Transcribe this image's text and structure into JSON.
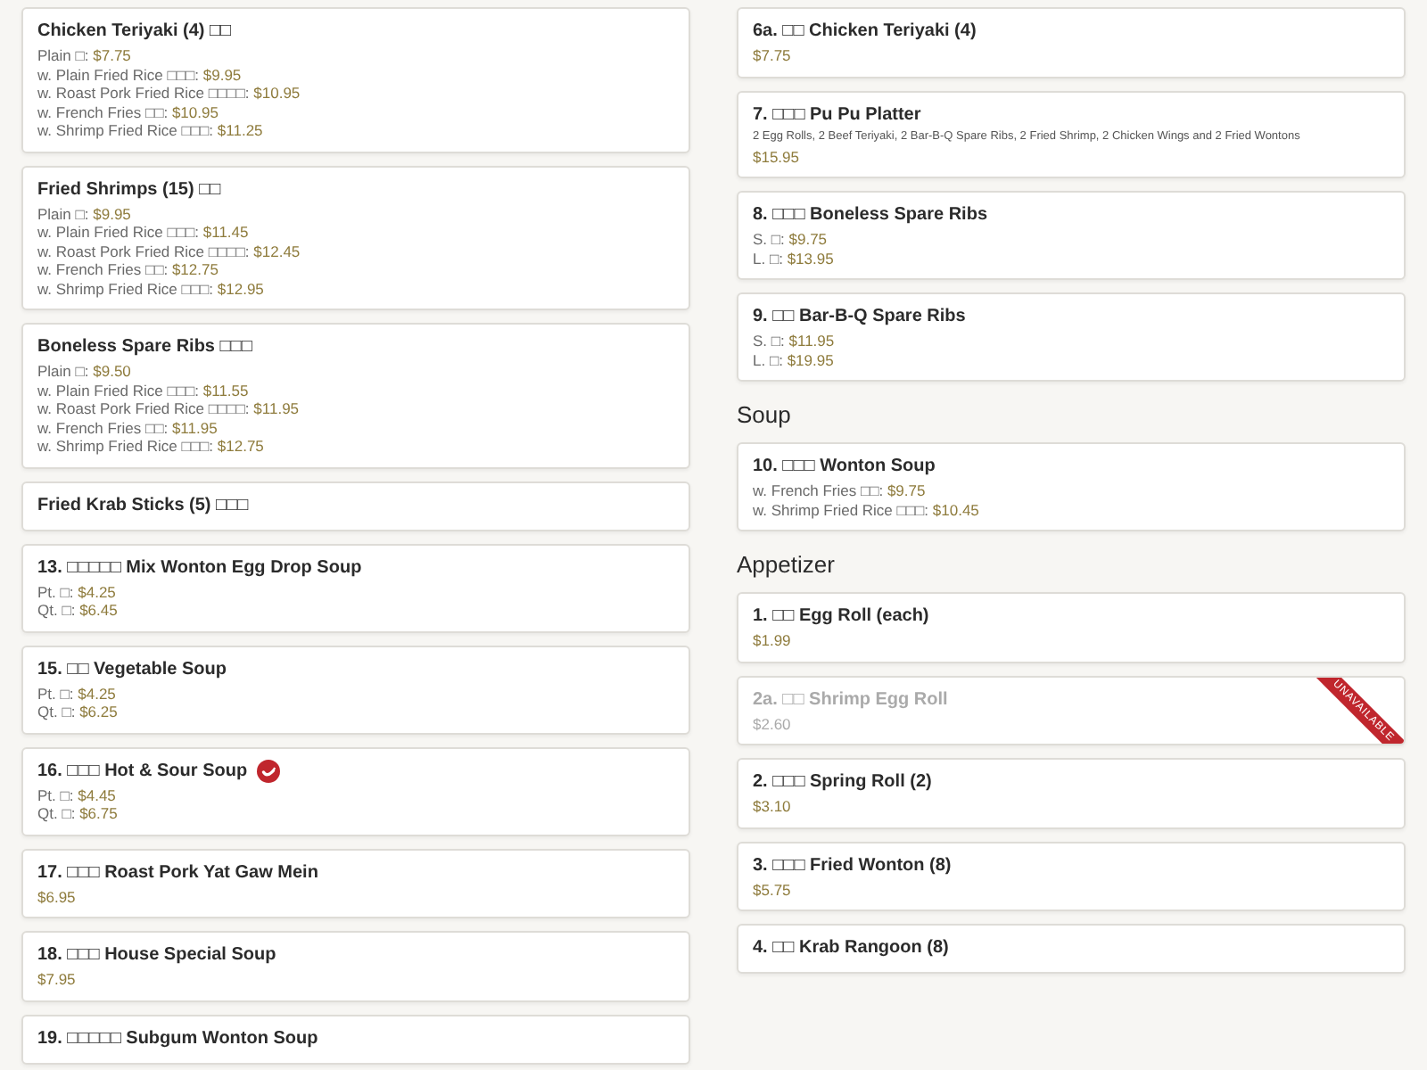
{
  "columns": [
    {
      "blocks": [
        {
          "kind": "card",
          "title": "Chicken Teriyaki (4) □□",
          "prices": [
            {
              "label": "Plain □:",
              "price": "$7.75"
            },
            {
              "label": "w. Plain Fried Rice □□□:",
              "price": "$9.95"
            },
            {
              "label": "w. Roast Pork Fried Rice □□□□:",
              "price": "$10.95"
            },
            {
              "label": "w. French Fries □□:",
              "price": "$10.95"
            },
            {
              "label": "w. Shrimp Fried Rice □□□:",
              "price": "$11.25"
            }
          ]
        },
        {
          "kind": "card",
          "title": "Fried Shrimps (15) □□",
          "prices": [
            {
              "label": "Plain □:",
              "price": "$9.95"
            },
            {
              "label": "w. Plain Fried Rice □□□:",
              "price": "$11.45"
            },
            {
              "label": "w. Roast Pork Fried Rice □□□□:",
              "price": "$12.45"
            },
            {
              "label": "w. French Fries □□:",
              "price": "$12.75"
            },
            {
              "label": "w. Shrimp Fried Rice □□□:",
              "price": "$12.95"
            }
          ]
        },
        {
          "kind": "card",
          "title": "Boneless Spare Ribs □□□",
          "prices": [
            {
              "label": "Plain □:",
              "price": "$9.50"
            },
            {
              "label": "w. Plain Fried Rice □□□:",
              "price": "$11.55"
            },
            {
              "label": "w. Roast Pork Fried Rice □□□□:",
              "price": "$11.95"
            },
            {
              "label": "w. French Fries □□:",
              "price": "$11.95"
            },
            {
              "label": "w. Shrimp Fried Rice □□□:",
              "price": "$12.75"
            }
          ]
        },
        {
          "kind": "card",
          "title": "Fried Krab Sticks (5) □□□"
        },
        {
          "kind": "card",
          "title": "13. □□□□□ Mix Wonton Egg Drop Soup",
          "prices": [
            {
              "label": "Pt. □:",
              "price": "$4.25"
            },
            {
              "label": "Qt. □:",
              "price": "$6.45"
            }
          ]
        },
        {
          "kind": "card",
          "title": "15. □□ Vegetable Soup",
          "prices": [
            {
              "label": "Pt. □:",
              "price": "$4.25"
            },
            {
              "label": "Qt. □:",
              "price": "$6.25"
            }
          ]
        },
        {
          "kind": "card",
          "title": "16. □□□ Hot & Sour Soup",
          "spicy": true,
          "prices": [
            {
              "label": "Pt. □:",
              "price": "$4.45"
            },
            {
              "label": "Qt. □:",
              "price": "$6.75"
            }
          ]
        },
        {
          "kind": "card",
          "title": "17. □□□ Roast Pork Yat Gaw Mein",
          "prices": [
            {
              "price": "$6.95"
            }
          ]
        },
        {
          "kind": "card",
          "title": "18. □□□ House Special Soup",
          "prices": [
            {
              "price": "$7.95"
            }
          ]
        },
        {
          "kind": "card",
          "title": "19. □□□□□ Subgum Wonton Soup"
        }
      ]
    },
    {
      "blocks": [
        {
          "kind": "card",
          "title": "6a. □□ Chicken Teriyaki (4)",
          "prices": [
            {
              "price": "$7.75"
            }
          ]
        },
        {
          "kind": "card",
          "title": "7. □□□ Pu Pu Platter",
          "description": "2 Egg Rolls, 2 Beef Teriyaki, 2 Bar-B-Q Spare Ribs, 2 Fried Shrimp, 2 Chicken Wings and 2 Fried Wontons",
          "prices": [
            {
              "price": "$15.95"
            }
          ]
        },
        {
          "kind": "card",
          "title": "8. □□□ Boneless Spare Ribs",
          "prices": [
            {
              "label": "S. □:",
              "price": "$9.75"
            },
            {
              "label": "L. □:",
              "price": "$13.95"
            }
          ]
        },
        {
          "kind": "card",
          "title": "9. □□ Bar-B-Q Spare Ribs",
          "prices": [
            {
              "label": "S. □:",
              "price": "$11.95"
            },
            {
              "label": "L. □:",
              "price": "$19.95"
            }
          ]
        },
        {
          "kind": "heading",
          "title": "Soup"
        },
        {
          "kind": "card",
          "title": "10. □□□ Wonton Soup",
          "prices": [
            {
              "label": "w. French Fries □□:",
              "price": "$9.75"
            },
            {
              "label": "w. Shrimp Fried Rice □□□:",
              "price": "$10.45"
            }
          ]
        },
        {
          "kind": "heading",
          "title": "Appetizer"
        },
        {
          "kind": "card",
          "title": "1. □□ Egg Roll (each)",
          "prices": [
            {
              "price": "$1.99"
            }
          ]
        },
        {
          "kind": "card",
          "title": "2a. □□ Shrimp Egg Roll",
          "available": false,
          "badge": "UNAVAILABLE",
          "prices": [
            {
              "price": "$2.60"
            }
          ]
        },
        {
          "kind": "card",
          "title": "2. □□□ Spring Roll (2)",
          "prices": [
            {
              "price": "$3.10"
            }
          ]
        },
        {
          "kind": "card",
          "title": "3. □□□ Fried Wonton (8)",
          "prices": [
            {
              "price": "$5.75"
            }
          ]
        },
        {
          "kind": "card",
          "title": "4. □□ Krab Rangoon (8)"
        }
      ]
    }
  ]
}
